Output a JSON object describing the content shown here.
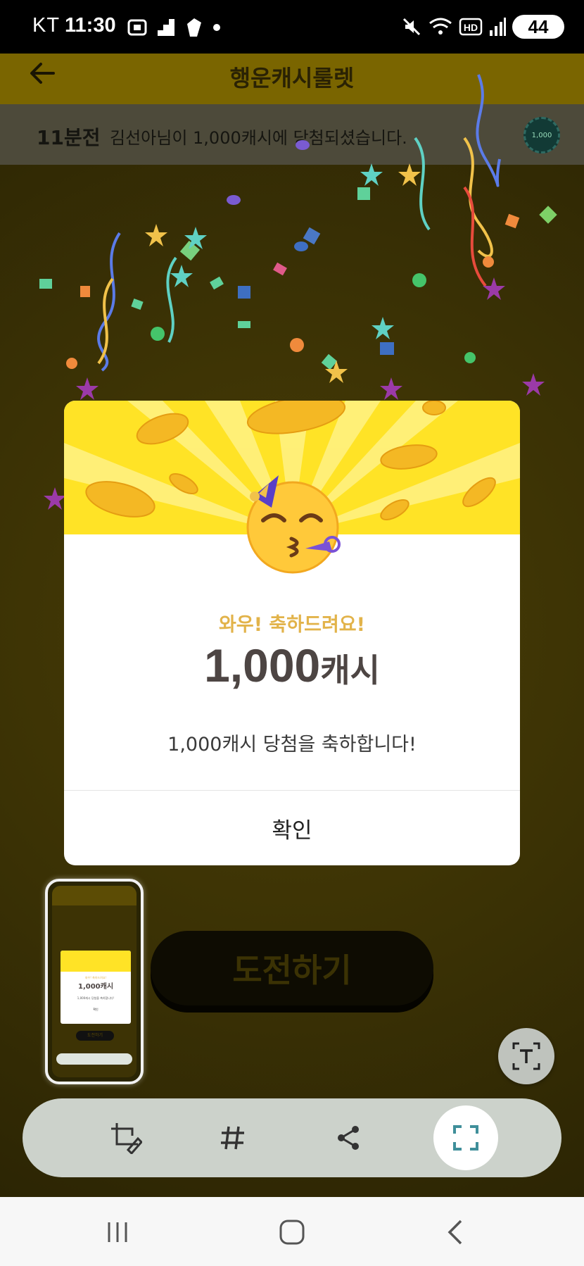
{
  "status_bar": {
    "carrier": "KT",
    "time": "11:30",
    "network_badge": "HD",
    "battery": "44"
  },
  "app": {
    "title": "행운캐시룰렛",
    "ticker_time": "11분전",
    "ticker_message": "김선아님이 1,000캐시에 당첨되셨습니다.",
    "chip_label": "1,000",
    "challenge_button": "도전하기"
  },
  "modal": {
    "subtitle": "와우! 축하드려요!",
    "amount": "1,000",
    "amount_unit": "캐시",
    "description": "1,000캐시 당첨을 축하합니다!",
    "confirm_label": "확인"
  },
  "thumbnail": {
    "subtitle": "와우! 축하드려요!",
    "amount": "1,000캐시",
    "description": "1,000캐시 당첨을 축하합니다!",
    "confirm": "확인",
    "challenge": "도전하기"
  },
  "colors": {
    "accent_yellow": "#ffe326",
    "subtitle_gold": "#e2b34a",
    "amount_text": "#4d4543"
  },
  "toolbar_icons": [
    "crop-edit-icon",
    "hashtag-icon",
    "share-icon",
    "capture-scroll-icon"
  ],
  "floating_icon": "text-extract-icon",
  "nav_icons": [
    "recent-apps-icon",
    "home-icon",
    "back-icon"
  ]
}
